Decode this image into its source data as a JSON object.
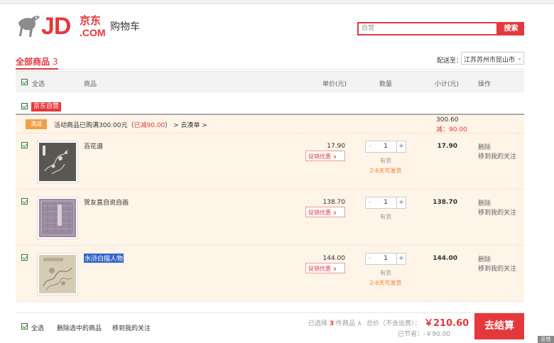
{
  "logo": {
    "main": "JD",
    "dot_com": ".COM",
    "cn": "京东"
  },
  "header": {
    "page_title": "购物车"
  },
  "search": {
    "value": "自营",
    "button": "搜索"
  },
  "tabs": {
    "all_label": "全部商品",
    "all_count": "3"
  },
  "shipping": {
    "label": "配送至：",
    "selected": "江苏苏州市昆山市"
  },
  "table_header": {
    "select_all": "全选",
    "product": "商品",
    "unit_price": "单价(元)",
    "quantity": "数量",
    "subtotal": "小计(元)",
    "actions": "操作"
  },
  "shop": {
    "name": "京东自营"
  },
  "promo": {
    "tag": "满减",
    "text_prefix": "活动商品已购满300.00元（",
    "text_reduced": "已减90.00",
    "text_suffix": "）",
    "go_link": "> 去凑单 >",
    "sum": "300.60",
    "reduced": "减：90.00"
  },
  "items": [
    {
      "name": "百花谱",
      "price": "17.90",
      "promo": "促销优惠 ∨",
      "qty": "1",
      "stock": "有货",
      "ship": "2-6天可发货",
      "subtotal": "17.90",
      "delete": "删除",
      "fav": "移到我的关注"
    },
    {
      "name": "贺友直自说自画",
      "price": "138.70",
      "promo": "促销优惠 ∨",
      "qty": "1",
      "stock": "有货",
      "ship": "",
      "subtotal": "138.70",
      "delete": "删除",
      "fav": "移到我的关注"
    },
    {
      "name": "水浒白描人物",
      "price": "144.00",
      "promo": "促销优惠 ∨",
      "qty": "1",
      "stock": "有货",
      "ship": "2-6天可发货",
      "subtotal": "144.00",
      "delete": "删除",
      "fav": "移到我的关注"
    }
  ],
  "footer": {
    "select_all": "全选",
    "delete_selected": "删除选中的商品",
    "move_to_fav": "移到我的关注",
    "selected_prefix": "已选择",
    "selected_count": "3",
    "selected_suffix": "件商品 ∧",
    "total_label": "总价（不含运费）：",
    "total": "￥210.60",
    "saved_label": "已节省：",
    "saved": "-￥90.00",
    "checkout": "去结算"
  },
  "corner_label": "反馈",
  "colors": {
    "accent": "#e4393c",
    "promo_bg": "#fff4e8",
    "promo_tag": "#f0a040"
  }
}
